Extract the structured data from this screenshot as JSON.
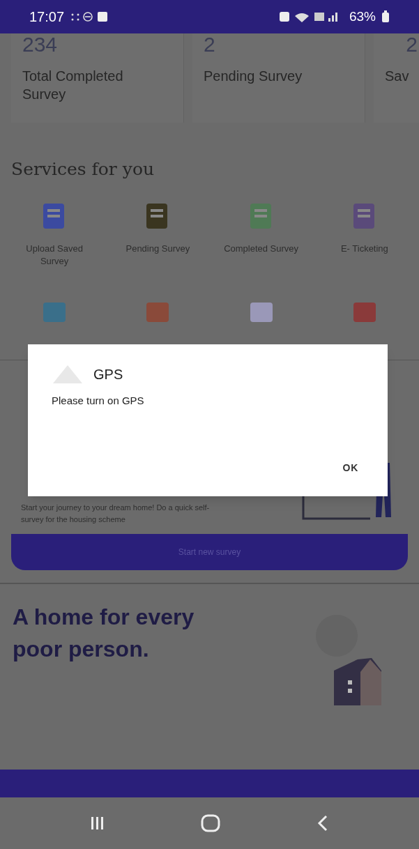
{
  "status_bar": {
    "time": "17:07",
    "battery": "63%"
  },
  "stats": [
    {
      "value": "234",
      "label": "Total Completed Survey"
    },
    {
      "value": "2",
      "label": "Pending Survey"
    },
    {
      "value": "2",
      "label": "Sav"
    }
  ],
  "services": {
    "title": "Services for you",
    "items": [
      {
        "label": "Upload Saved Survey"
      },
      {
        "label": "Pending Survey"
      },
      {
        "label": "Completed Survey"
      },
      {
        "label": "E- Ticketing"
      }
    ]
  },
  "survey_card": {
    "description": "Start your journey to your dream home! Do a quick self-survey for the housing scheme",
    "button": "Start new survey"
  },
  "banner": {
    "headline": "A home for every poor person."
  },
  "dialog": {
    "title": "GPS",
    "message": "Please turn on GPS",
    "button": "OK"
  }
}
